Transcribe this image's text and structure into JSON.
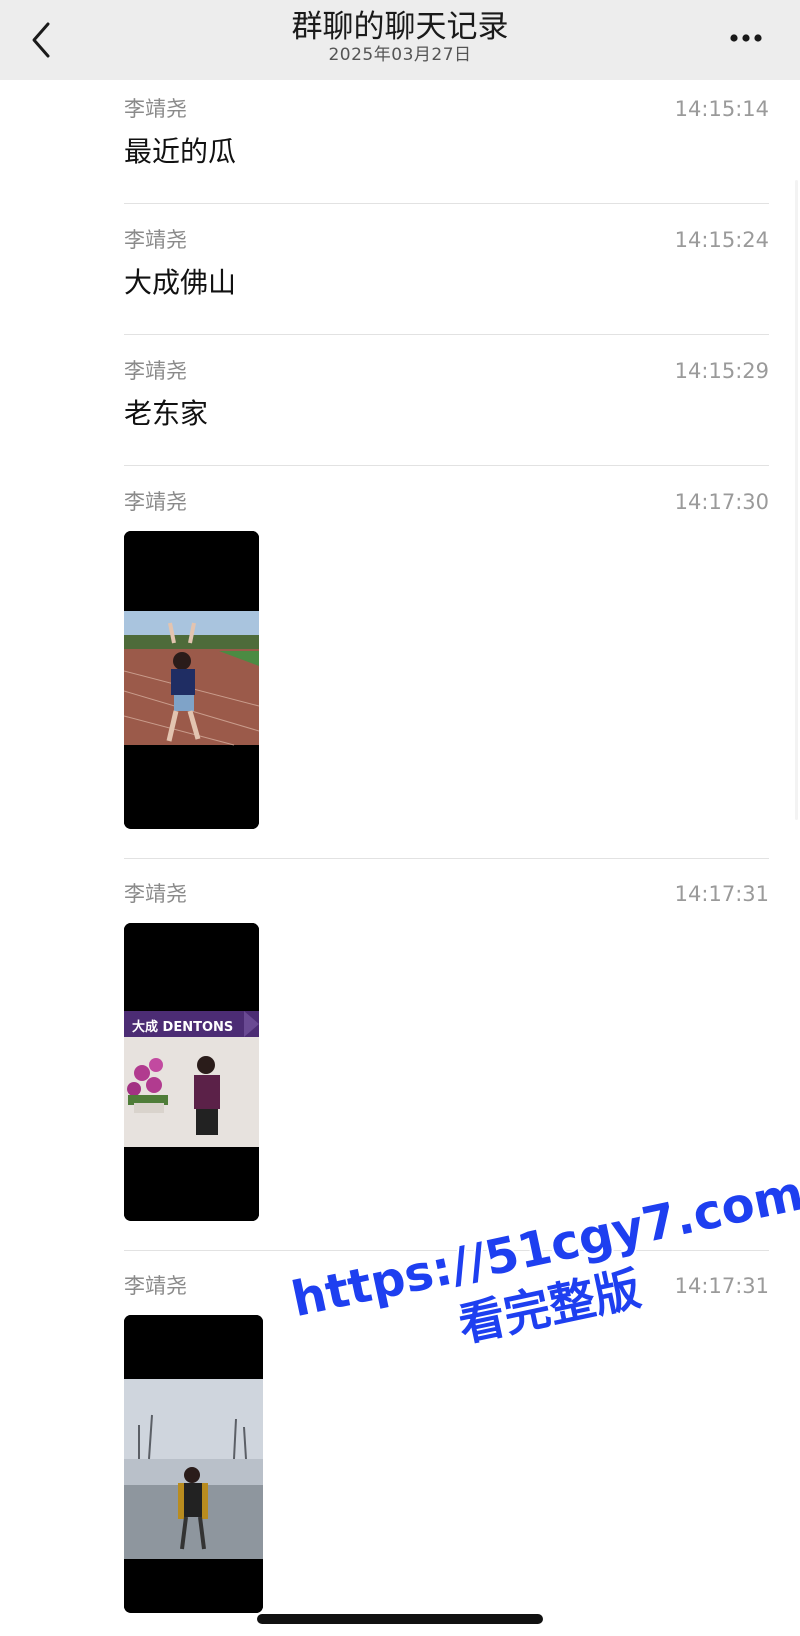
{
  "nav": {
    "title": "群聊的聊天记录",
    "date": "2025年03月27日",
    "back_icon": "chevron-left-icon",
    "more_icon": "ellipsis-icon"
  },
  "messages": [
    {
      "sender": "李靖尧",
      "time": "14:15:14",
      "text": "最近的瓜"
    },
    {
      "sender": "李靖尧",
      "time": "14:15:24",
      "text": "大成佛山"
    },
    {
      "sender": "李靖尧",
      "time": "14:15:29",
      "text": "老东家"
    },
    {
      "sender": "李靖尧",
      "time": "14:17:30",
      "type": "image"
    },
    {
      "sender": "李靖尧",
      "time": "14:17:31",
      "type": "image",
      "image_text": "大成 DENTONS"
    },
    {
      "sender": "李靖尧",
      "time": "14:17:31",
      "type": "image"
    }
  ],
  "watermark": {
    "url": "https://51cgy7.com",
    "sub": "看完整版",
    "color": "#1e3ff0"
  }
}
